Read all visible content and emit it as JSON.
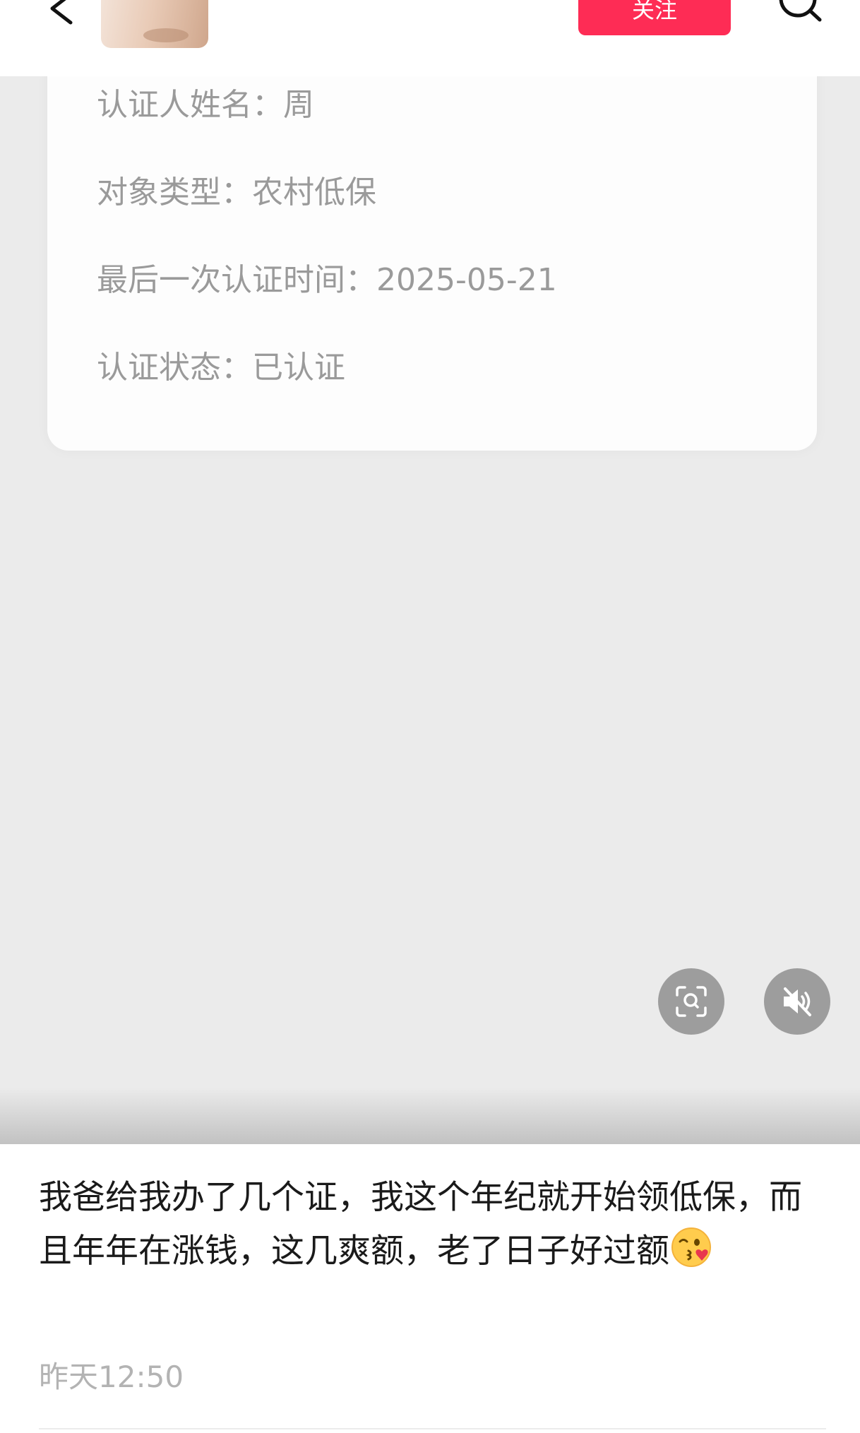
{
  "header": {
    "follow_label": "关注"
  },
  "icons": {
    "back": "chevron-left-icon",
    "search": "search-icon",
    "scan": "scan-search-icon",
    "mute": "speaker-muted-icon",
    "emoji": "kiss-wink-emoji"
  },
  "colors": {
    "accent": "#fe2c55",
    "media_background": "#ebebeb",
    "card_text": "#9a9a9a"
  },
  "card": {
    "name_line": "认证人姓名：周",
    "type_line": "对象类型：农村低保",
    "date_line": "最后一次认证时间：2025-05-21",
    "status_line": "认证状态：已认证"
  },
  "post": {
    "caption": "我爸给我办了几个证，我这个年纪就开始领低保，而且年年在涨钱，这几爽额，老了日子好过额",
    "time": "昨天12:50"
  }
}
